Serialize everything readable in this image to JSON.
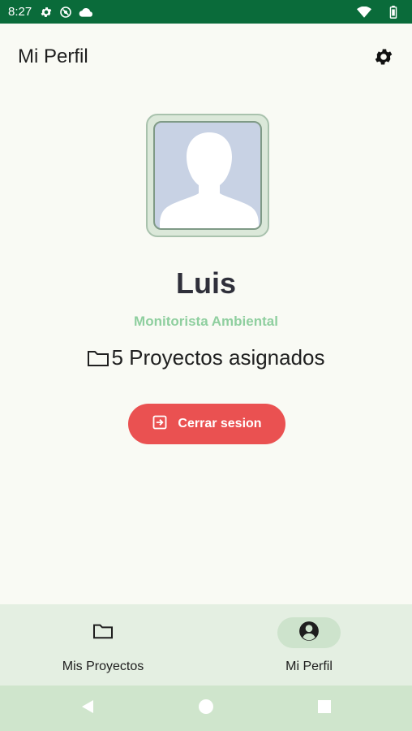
{
  "status_bar": {
    "time": "8:27",
    "icons": [
      "settings-icon",
      "no-disturb-icon",
      "cloud-icon",
      "wifi-icon",
      "battery-icon"
    ]
  },
  "header": {
    "title": "Mi Perfil",
    "settings_icon": "gear-icon"
  },
  "profile": {
    "avatar_icon": "person-silhouette",
    "name": "Luis",
    "role": "Monitorista Ambiental",
    "projects_text": "5 Proyectos asignados",
    "projects_icon": "folder-icon"
  },
  "actions": {
    "logout_label": "Cerrar sesion",
    "logout_icon": "logout-icon"
  },
  "bottom_nav": {
    "items": [
      {
        "label": "Mis Proyectos",
        "icon": "folder-icon",
        "active": false
      },
      {
        "label": "Mi Perfil",
        "icon": "account-circle-icon",
        "active": true
      }
    ]
  },
  "colors": {
    "status_bar": "#0a6b3a",
    "background": "#f9faf4",
    "accent_role": "#8fcf9f",
    "logout_button": "#ea5151",
    "nav_background": "#e4efe2",
    "nav_active_pill": "#cde3cc"
  }
}
